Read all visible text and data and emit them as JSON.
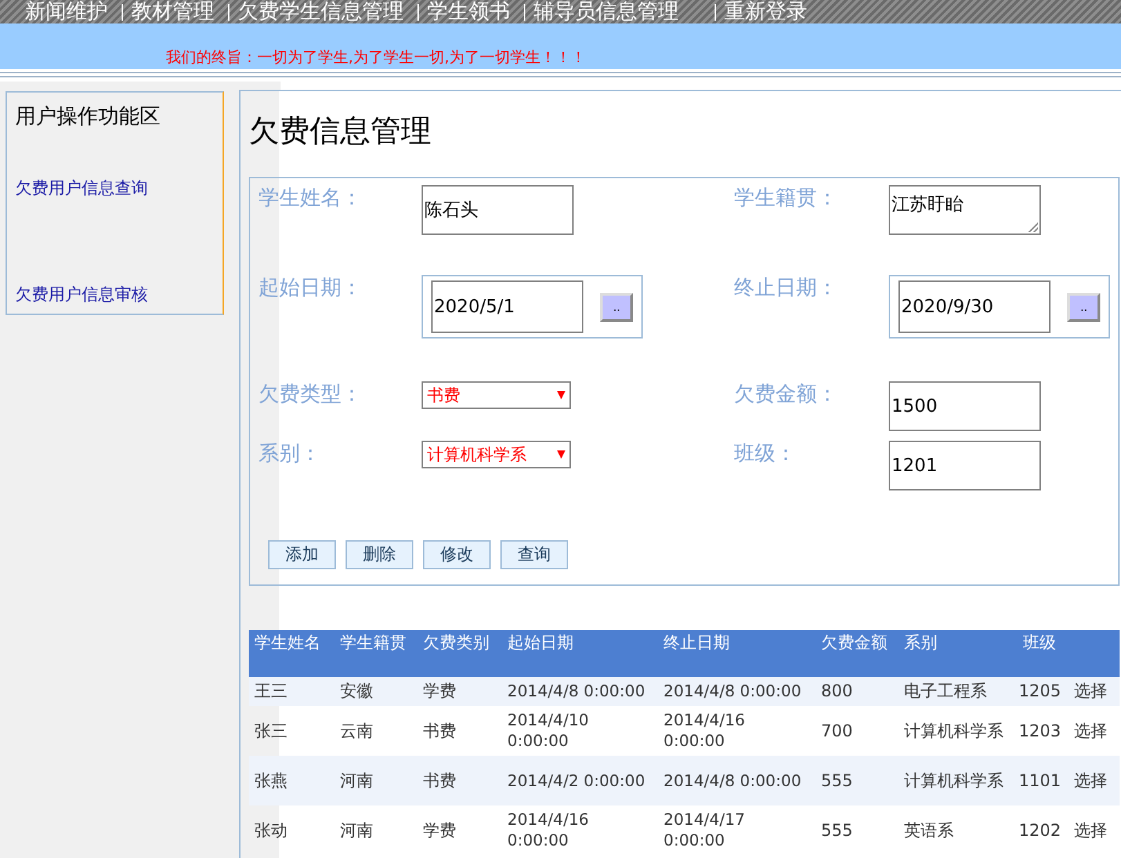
{
  "nav": {
    "items": [
      {
        "label": "新闻维护"
      },
      {
        "label": "教材管理"
      },
      {
        "label": "欠费学生信息管理"
      },
      {
        "label": "学生领书"
      },
      {
        "label": "辅导员信息管理"
      },
      {
        "label": "重新登录"
      }
    ]
  },
  "banner": {
    "slogan": "我们的终旨：一切为了学生,为了学生一切,为了一切学生！！！"
  },
  "sidebar": {
    "title": "用户操作功能区",
    "items": [
      {
        "label": "欠费用户信息查询"
      },
      {
        "label": "欠费用户信息审核"
      }
    ]
  },
  "page_title": "欠费信息管理",
  "form": {
    "rows": [
      [
        {
          "label": "学生姓名：",
          "kind": "text",
          "value": "陈石头"
        },
        {
          "label": "学生籍贯：",
          "kind": "textarea",
          "value": "江苏盱眙"
        }
      ],
      [
        {
          "label": "起始日期：",
          "kind": "date",
          "value": "2020/5/1",
          "button": ".."
        },
        {
          "label": "终止日期：",
          "kind": "date",
          "value": "2020/9/30",
          "button": ".."
        }
      ],
      [
        {
          "label": "欠费类型：",
          "kind": "select",
          "value": "书费"
        },
        {
          "label": "欠费金额：",
          "kind": "text",
          "value": "1500"
        }
      ],
      [
        {
          "label": "系别：",
          "kind": "select",
          "value": "计算机科学系"
        },
        {
          "label": "班级：",
          "kind": "text",
          "value": "1201"
        }
      ]
    ],
    "buttons": [
      "添加",
      "删除",
      "修改",
      "查询"
    ]
  },
  "table": {
    "columns": [
      "学生姓名",
      "学生籍贯",
      "欠费类别",
      "起始日期",
      "终止日期",
      "欠费金额",
      "系别",
      "班级"
    ],
    "rows": [
      [
        "王三",
        "安徽",
        "学费",
        "2014/4/8 0:00:00",
        "2014/4/8 0:00:00",
        "800",
        "电子工程系",
        "1205",
        "选择"
      ],
      [
        "张三",
        "云南",
        "书费",
        "2014/4/10 0:00:00",
        "2014/4/16 0:00:00",
        "700",
        "计算机科学系",
        "1203",
        "选择"
      ],
      [
        "张燕",
        "河南",
        "书费",
        "2014/4/2 0:00:00",
        "2014/4/8 0:00:00",
        "555",
        "计算机科学系",
        "1101",
        "选择"
      ],
      [
        "张动",
        "河南",
        "学费",
        "2014/4/16 0:00:00",
        "2014/4/17 0:00:00",
        "555",
        "英语系",
        "1202",
        "选择"
      ]
    ]
  }
}
